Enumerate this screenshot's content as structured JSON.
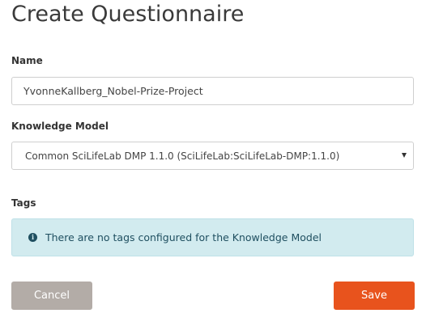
{
  "page": {
    "title": "Create Questionnaire"
  },
  "form": {
    "name_label": "Name",
    "name_value": "YvonneKallberg_Nobel-Prize-Project",
    "km_label": "Knowledge Model",
    "km_selected": "Common SciLifeLab DMP 1.1.0 (SciLifeLab:SciLifeLab-DMP:1.1.0)",
    "tags_label": "Tags",
    "tags_info": "There are no tags configured for the Knowledge Model",
    "info_icon": "info-circle-icon",
    "dropdown_icon": "caret-down-icon"
  },
  "actions": {
    "cancel_label": "Cancel",
    "save_label": "Save"
  },
  "colors": {
    "save_button": "#e8531d",
    "cancel_button": "#b3aca7",
    "info_background": "#d2ebef",
    "info_text": "#1f4f60"
  }
}
